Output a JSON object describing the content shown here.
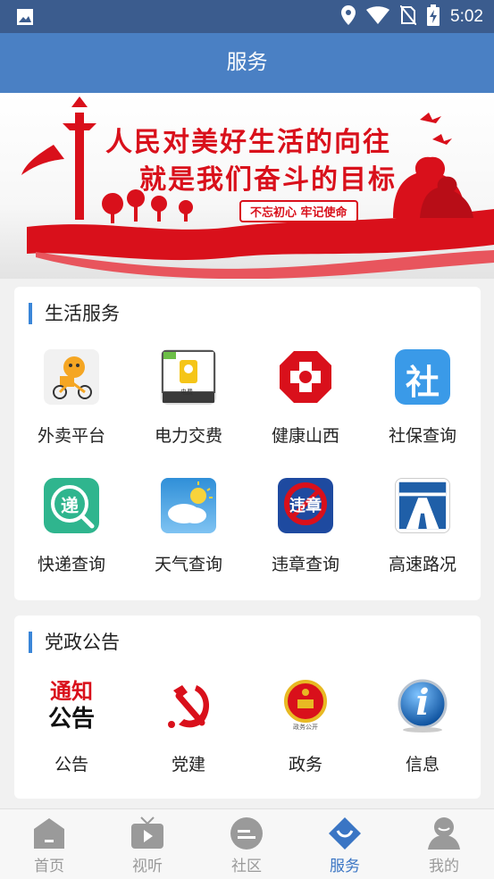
{
  "status_bar": {
    "time": "5:02",
    "icons": [
      "image-icon",
      "location-icon",
      "wifi-icon",
      "no-sim-icon",
      "battery-charging-icon"
    ]
  },
  "header": {
    "title": "服务"
  },
  "banner": {
    "line1": "人民对美好生活的向往",
    "line2": "就是我们奋斗的目标",
    "tag": "不忘初心 牢记使命"
  },
  "life_services": {
    "title": "生活服务",
    "items": [
      {
        "label": "外卖平台",
        "icon": "takeout-icon"
      },
      {
        "label": "电力交费",
        "icon": "electricity-icon",
        "icon_text": "电费"
      },
      {
        "label": "健康山西",
        "icon": "health-cross-icon"
      },
      {
        "label": "社保查询",
        "icon": "social-security-icon",
        "icon_text": "社"
      },
      {
        "label": "快递查询",
        "icon": "express-icon",
        "icon_text": "递"
      },
      {
        "label": "天气查询",
        "icon": "weather-icon"
      },
      {
        "label": "违章查询",
        "icon": "violation-icon",
        "icon_text": "违章"
      },
      {
        "label": "高速路况",
        "icon": "highway-icon"
      }
    ]
  },
  "party_notices": {
    "title": "党政公告",
    "items": [
      {
        "label": "公告",
        "icon": "notice-icon",
        "icon_text_top": "通知",
        "icon_text_bottom": "公告"
      },
      {
        "label": "党建",
        "icon": "party-emblem-icon"
      },
      {
        "label": "政务",
        "icon": "national-emblem-icon",
        "icon_text": "政务公开"
      },
      {
        "label": "信息",
        "icon": "info-icon",
        "icon_text": "i"
      }
    ]
  },
  "bottom_nav": {
    "items": [
      {
        "label": "首页",
        "icon": "home-icon",
        "active": false
      },
      {
        "label": "视听",
        "icon": "tv-icon",
        "active": false
      },
      {
        "label": "社区",
        "icon": "community-icon",
        "active": false
      },
      {
        "label": "服务",
        "icon": "service-icon",
        "active": true
      },
      {
        "label": "我的",
        "icon": "profile-icon",
        "active": false
      }
    ]
  },
  "colors": {
    "status_bar": "#3b5c8e",
    "header": "#4a80c4",
    "accent": "#3a86d8",
    "banner_red": "#d9101b",
    "nav_active": "#3a75c4",
    "nav_inactive": "#9a9a9a"
  }
}
